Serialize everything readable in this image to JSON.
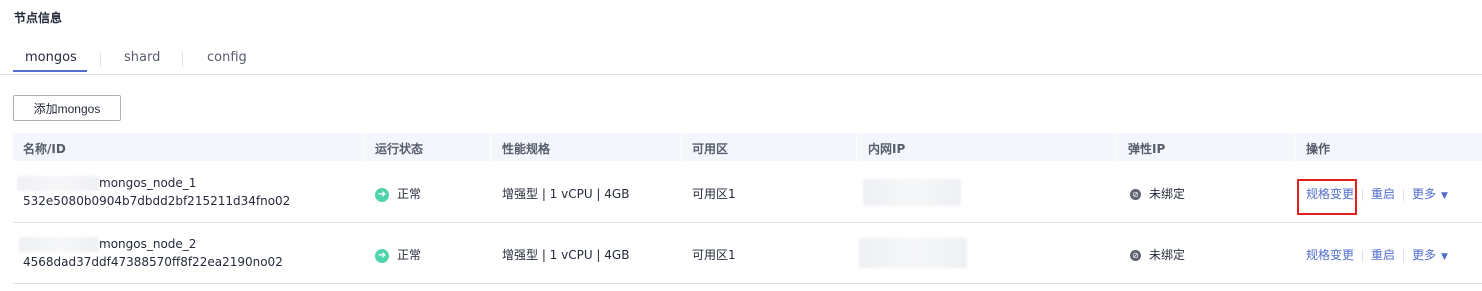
{
  "section_title": "节点信息",
  "tabs": [
    {
      "label": "mongos",
      "active": true
    },
    {
      "label": "shard",
      "active": false
    },
    {
      "label": "config",
      "active": false
    }
  ],
  "add_button_label": "添加mongos",
  "table": {
    "headers": [
      "名称/ID",
      "运行状态",
      "性能规格",
      "可用区",
      "内网IP",
      "弹性IP",
      "操作"
    ],
    "rows": [
      {
        "name": "mongos_node_1",
        "id": "532e5080b0904b7dbdd2bf215211d34fno02",
        "status": "正常",
        "spec": "增强型 | 1 vCPU | 4GB",
        "zone": "可用区1",
        "eip": "未绑定",
        "actions": {
          "resize": "规格变更",
          "restart": "重启",
          "more": "更多"
        }
      },
      {
        "name": "mongos_node_2",
        "id": "4568dad37ddf47388570ff8f22ea2190no02",
        "status": "正常",
        "spec": "增强型 | 1 vCPU | 4GB",
        "zone": "可用区1",
        "eip": "未绑定",
        "actions": {
          "resize": "规格变更",
          "restart": "重启",
          "more": "更多"
        }
      }
    ]
  },
  "colors": {
    "accent": "#526ecc",
    "status_ok": "#50d4ab",
    "highlight": "#e0201a"
  }
}
